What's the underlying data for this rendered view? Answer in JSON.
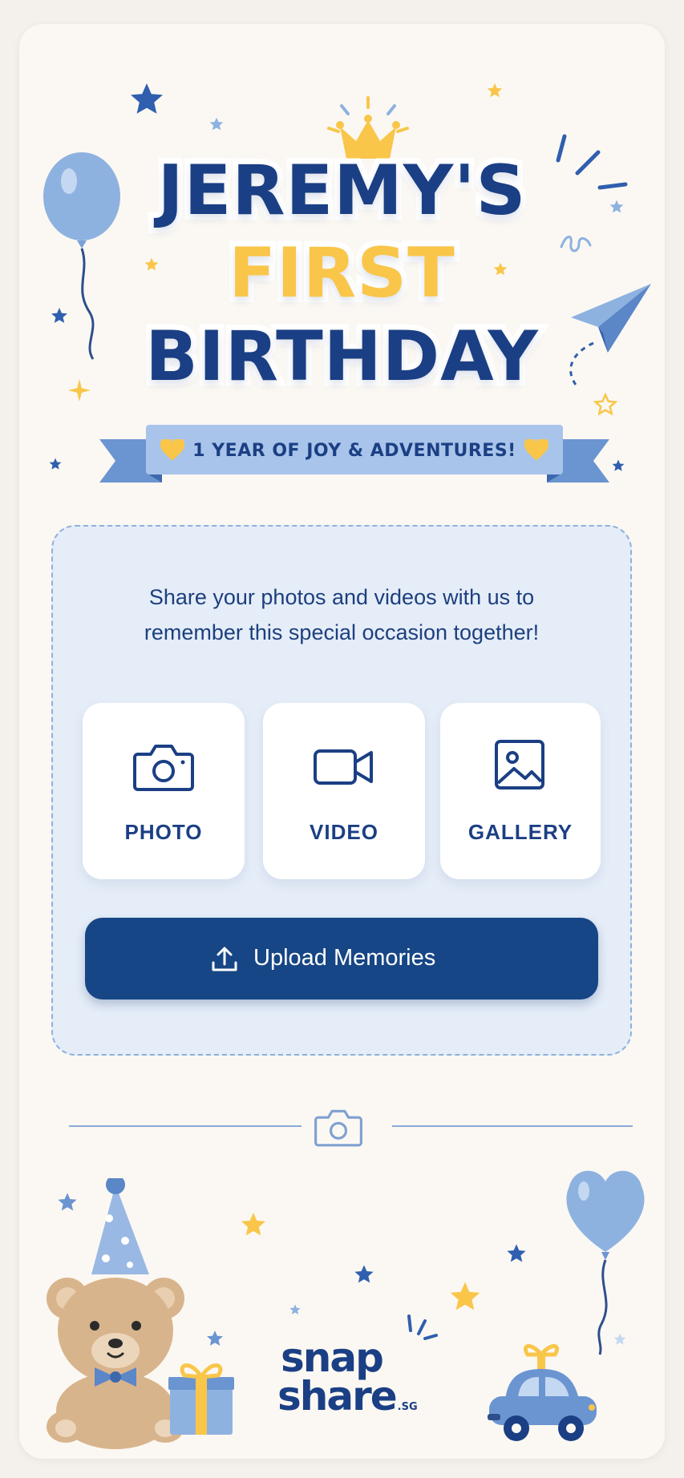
{
  "title": {
    "line1": "JEREMY'S",
    "line2": "FIRST",
    "line3": "BIRTHDAY"
  },
  "ribbon": {
    "text": "1 YEAR OF JOY & ADVENTURES!"
  },
  "upload_panel": {
    "message_line1": "Share your photos and videos with us to",
    "message_line2": "remember this special occasion together!",
    "options": [
      {
        "label": "PHOTO",
        "icon": "camera-icon"
      },
      {
        "label": "VIDEO",
        "icon": "video-camera-icon"
      },
      {
        "label": "GALLERY",
        "icon": "image-icon"
      }
    ],
    "upload_button_label": "Upload Memories"
  },
  "footer": {
    "logo_line1": "snap",
    "logo_line2": "share",
    "logo_suffix": ".SG"
  },
  "colors": {
    "navy": "#164685",
    "title_blue": "#1b3f84",
    "gold": "#f9c64a",
    "light_blue": "#8fb0dc",
    "panel_bg": "#e5edf8"
  }
}
